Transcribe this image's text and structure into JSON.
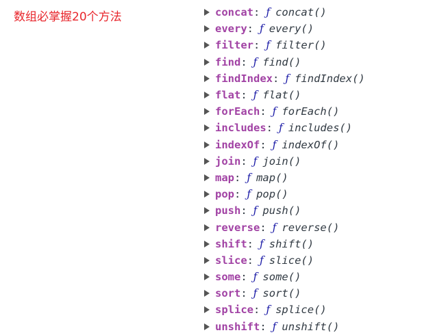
{
  "page_title": "数组必掌握20个方法",
  "colors": {
    "title": "#e8262c",
    "key": "#a142a4",
    "function_glyph": "#1a1aa6",
    "text": "#303942",
    "arrow": "#555555"
  },
  "icons": {
    "expand": "triangle-right-icon"
  },
  "properties": [
    {
      "key": "concat",
      "sep": ":",
      "glyph": "ƒ",
      "signature": "concat()"
    },
    {
      "key": "every",
      "sep": ":",
      "glyph": "ƒ",
      "signature": "every()"
    },
    {
      "key": "filter",
      "sep": ":",
      "glyph": "ƒ",
      "signature": "filter()"
    },
    {
      "key": "find",
      "sep": ":",
      "glyph": "ƒ",
      "signature": "find()"
    },
    {
      "key": "findIndex",
      "sep": ":",
      "glyph": "ƒ",
      "signature": "findIndex()"
    },
    {
      "key": "flat",
      "sep": ":",
      "glyph": "ƒ",
      "signature": "flat()"
    },
    {
      "key": "forEach",
      "sep": ":",
      "glyph": "ƒ",
      "signature": "forEach()"
    },
    {
      "key": "includes",
      "sep": ":",
      "glyph": "ƒ",
      "signature": "includes()"
    },
    {
      "key": "indexOf",
      "sep": ":",
      "glyph": "ƒ",
      "signature": "indexOf()"
    },
    {
      "key": "join",
      "sep": ":",
      "glyph": "ƒ",
      "signature": "join()"
    },
    {
      "key": "map",
      "sep": ":",
      "glyph": "ƒ",
      "signature": "map()"
    },
    {
      "key": "pop",
      "sep": ":",
      "glyph": "ƒ",
      "signature": "pop()"
    },
    {
      "key": "push",
      "sep": ":",
      "glyph": "ƒ",
      "signature": "push()"
    },
    {
      "key": "reverse",
      "sep": ":",
      "glyph": "ƒ",
      "signature": "reverse()"
    },
    {
      "key": "shift",
      "sep": ":",
      "glyph": "ƒ",
      "signature": "shift()"
    },
    {
      "key": "slice",
      "sep": ":",
      "glyph": "ƒ",
      "signature": "slice()"
    },
    {
      "key": "some",
      "sep": ":",
      "glyph": "ƒ",
      "signature": "some()"
    },
    {
      "key": "sort",
      "sep": ":",
      "glyph": "ƒ",
      "signature": "sort()"
    },
    {
      "key": "splice",
      "sep": ":",
      "glyph": "ƒ",
      "signature": "splice()"
    },
    {
      "key": "unshift",
      "sep": ":",
      "glyph": "ƒ",
      "signature": "unshift()"
    }
  ]
}
